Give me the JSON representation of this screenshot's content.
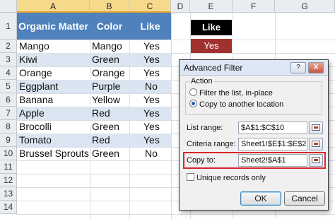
{
  "sheet": {
    "columns": [
      "A",
      "B",
      "C",
      "D",
      "E",
      "F",
      "G"
    ],
    "rows": [
      "1",
      "2",
      "3",
      "4",
      "5",
      "6",
      "7",
      "8",
      "9",
      "10",
      "11",
      "12",
      "13",
      "14"
    ],
    "headers": {
      "a": "Organic Matter",
      "b": "Color",
      "c": "Like"
    },
    "data": [
      [
        "Mango",
        "Mango",
        "Yes"
      ],
      [
        "Kiwi",
        "Green",
        "Yes"
      ],
      [
        "Orange",
        "Orange",
        "Yes"
      ],
      [
        "Eggplant",
        "Purple",
        "No"
      ],
      [
        "Banana",
        "Yellow",
        "Yes"
      ],
      [
        "Apple",
        "Red",
        "Yes"
      ],
      [
        "Brocolli",
        "Green",
        "Yes"
      ],
      [
        "Tomato",
        "Red",
        "Yes"
      ],
      [
        "Brussel Sprouts",
        "Green",
        "No"
      ]
    ],
    "criteria_header": "Like",
    "criteria_value": "Yes",
    "colors": {
      "header_blue": "#4f81bd",
      "band": "#dbe5f1",
      "criteria_red": "#a0312e"
    }
  },
  "dialog": {
    "title": "Advanced Filter",
    "help_button": "?",
    "close_button": "X",
    "action_label": "Action",
    "option_filter": "Filter the list, in-place",
    "option_copy": "Copy to another location",
    "list_range_label": "List range:",
    "list_range_value": "$A$1:$C$10",
    "criteria_range_label": "Criteria range:",
    "criteria_range_value": "Sheet1!$E$1:$E$2",
    "copy_to_label": "Copy to:",
    "copy_to_value": "Sheet2!$A$1",
    "unique_label": "Unique records only",
    "ok_label": "OK",
    "cancel_label": "Cancel",
    "icons": [
      "collapse-dialog-icon"
    ]
  }
}
